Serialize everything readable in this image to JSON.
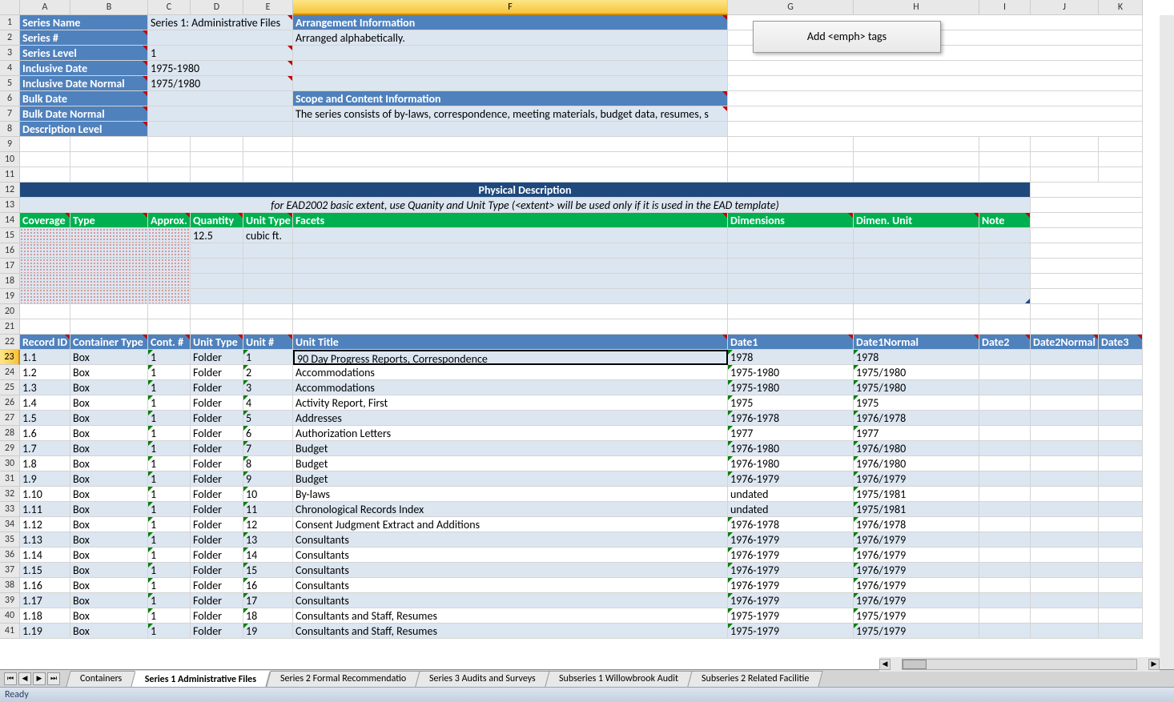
{
  "button_label": "Add <emph> tags",
  "status": "Ready",
  "col_letters": [
    "A",
    "B",
    "C",
    "D",
    "E",
    "F",
    "G",
    "H",
    "I",
    "J",
    "K"
  ],
  "selected_col": "F",
  "selected_row": 23,
  "tabs": [
    "Containers",
    "Series 1 Administrative Files",
    "Series 2 Formal Recommendatio",
    "Series 3 Audits and Surveys",
    "Subseries 1 Willowbrook Audit",
    "Subseries 2 Related Facilitie"
  ],
  "active_tab": 1,
  "top": {
    "r1": {
      "a": "Series Name",
      "c": "Series 1: Administrative Files",
      "f": "Arrangement Information"
    },
    "r2": {
      "a": "Series #",
      "f": "Arranged alphabetically."
    },
    "r3": {
      "a": "Series Level",
      "c": "1"
    },
    "r4": {
      "a": "Inclusive Date",
      "c": "1975-1980"
    },
    "r5": {
      "a": "Inclusive Date Normal",
      "c": "1975/1980"
    },
    "r6": {
      "a": "Bulk Date",
      "f": "Scope and Content Information"
    },
    "r7": {
      "a": "Bulk Date Normal",
      "f": "The series consists of by-laws, correspondence, meeting materials, budget  data, resumes, s"
    },
    "r8": {
      "a": "Description Level"
    }
  },
  "phys_desc_title": "Physical Description",
  "phys_desc_note": "for EAD2002 basic extent, use Quanity and Unit Type (<extent> will be used only if it is used in the EAD template)",
  "phys_hdr": {
    "a": "Coverage",
    "b": "Type",
    "c": "Approx.",
    "d": "Quantity",
    "e": "Unit Type",
    "f": "Facets",
    "g": "Dimensions",
    "h": "Dimen. Unit",
    "i": "Note"
  },
  "phys_r15": {
    "d": "12.5",
    "e": "cubic ft."
  },
  "table_hdr": {
    "a": "Record ID",
    "b": "Container Type",
    "c": "Cont. #",
    "d": "Unit Type",
    "e": "Unit #",
    "f": "Unit Title",
    "g": "Date1",
    "h": "Date1Normal",
    "i": "Date2",
    "j": "Date2Normal",
    "k": "Date3"
  },
  "rows": [
    {
      "a": "1.1",
      "b": "Box",
      "c": "1",
      "d": "Folder",
      "e": "1",
      "f": "90 Day Progress Reports, Correspondence",
      "g": "1978",
      "h": "1978"
    },
    {
      "a": "1.2",
      "b": "Box",
      "c": "1",
      "d": "Folder",
      "e": "2",
      "f": "Accommodations",
      "g": "1975-1980",
      "h": "1975/1980"
    },
    {
      "a": "1.3",
      "b": "Box",
      "c": "1",
      "d": "Folder",
      "e": "3",
      "f": "Accommodations",
      "g": "1975-1980",
      "h": "1975/1980"
    },
    {
      "a": "1.4",
      "b": "Box",
      "c": "1",
      "d": "Folder",
      "e": "4",
      "f": "Activity Report, First",
      "g": "1975",
      "h": "1975"
    },
    {
      "a": "1.5",
      "b": "Box",
      "c": "1",
      "d": "Folder",
      "e": "5",
      "f": "Addresses",
      "g": "1976-1978",
      "h": "1976/1978"
    },
    {
      "a": "1.6",
      "b": "Box",
      "c": "1",
      "d": "Folder",
      "e": "6",
      "f": "Authorization Letters",
      "g": "1977",
      "h": "1977"
    },
    {
      "a": "1.7",
      "b": "Box",
      "c": "1",
      "d": "Folder",
      "e": "7",
      "f": "Budget",
      "g": "1976-1980",
      "h": "1976/1980"
    },
    {
      "a": "1.8",
      "b": "Box",
      "c": "1",
      "d": "Folder",
      "e": "8",
      "f": "Budget",
      "g": "1976-1980",
      "h": "1976/1980"
    },
    {
      "a": "1.9",
      "b": "Box",
      "c": "1",
      "d": "Folder",
      "e": "9",
      "f": "Budget",
      "g": "1976-1979",
      "h": "1976/1979"
    },
    {
      "a": "1.10",
      "b": "Box",
      "c": "1",
      "d": "Folder",
      "e": "10",
      "f": "By-laws",
      "g": "undated",
      "h": "1975/1981"
    },
    {
      "a": "1.11",
      "b": "Box",
      "c": "1",
      "d": "Folder",
      "e": "11",
      "f": "Chronological Records Index",
      "g": "undated",
      "h": "1975/1981"
    },
    {
      "a": "1.12",
      "b": "Box",
      "c": "1",
      "d": "Folder",
      "e": "12",
      "f": "Consent Judgment Extract and Additions",
      "g": "1976-1978",
      "h": "1976/1978"
    },
    {
      "a": "1.13",
      "b": "Box",
      "c": "1",
      "d": "Folder",
      "e": "13",
      "f": "Consultants",
      "g": "1976-1979",
      "h": "1976/1979"
    },
    {
      "a": "1.14",
      "b": "Box",
      "c": "1",
      "d": "Folder",
      "e": "14",
      "f": "Consultants",
      "g": "1976-1979",
      "h": "1976/1979"
    },
    {
      "a": "1.15",
      "b": "Box",
      "c": "1",
      "d": "Folder",
      "e": "15",
      "f": "Consultants",
      "g": "1976-1979",
      "h": "1976/1979"
    },
    {
      "a": "1.16",
      "b": "Box",
      "c": "1",
      "d": "Folder",
      "e": "16",
      "f": "Consultants",
      "g": "1976-1979",
      "h": "1976/1979"
    },
    {
      "a": "1.17",
      "b": "Box",
      "c": "1",
      "d": "Folder",
      "e": "17",
      "f": "Consultants",
      "g": "1976-1979",
      "h": "1976/1979"
    },
    {
      "a": "1.18",
      "b": "Box",
      "c": "1",
      "d": "Folder",
      "e": "18",
      "f": "Consultants and Staff, Resumes",
      "g": "1975-1979",
      "h": "1975/1979"
    },
    {
      "a": "1.19",
      "b": "Box",
      "c": "1",
      "d": "Folder",
      "e": "19",
      "f": "Consultants and Staff, Resumes",
      "g": "1975-1979",
      "h": "1975/1979"
    }
  ]
}
